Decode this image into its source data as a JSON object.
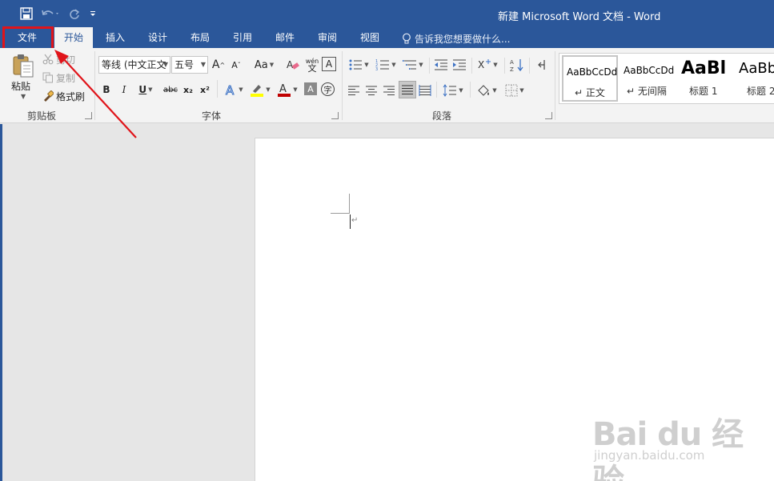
{
  "titlebar": {
    "title": "新建 Microsoft Word 文档 - Word"
  },
  "tabs": [
    {
      "label": "文件"
    },
    {
      "label": "开始"
    },
    {
      "label": "插入"
    },
    {
      "label": "设计"
    },
    {
      "label": "布局"
    },
    {
      "label": "引用"
    },
    {
      "label": "邮件"
    },
    {
      "label": "审阅"
    },
    {
      "label": "视图"
    }
  ],
  "tell_me": "告诉我您想要做什么...",
  "clipboard": {
    "paste": "粘贴",
    "cut": "剪切",
    "copy": "复制",
    "format_painter": "格式刷",
    "group_label": "剪贴板"
  },
  "font": {
    "font_name": "等线 (中文正文",
    "font_size": "五号",
    "change_case": "Aa",
    "bold": "B",
    "italic": "I",
    "underline": "U",
    "strikethrough": "abc",
    "subscript": "x₂",
    "superscript": "x²",
    "grow": "A",
    "shrink": "A",
    "clear": "A",
    "char_border": "A",
    "phonetic": "wén",
    "enclose": "字",
    "group_label": "字体"
  },
  "paragraph": {
    "group_label": "段落"
  },
  "styles": {
    "items": [
      {
        "sample": "AaBbCcDd",
        "name": "↵ 正文"
      },
      {
        "sample": "AaBbCcDd",
        "name": "↵ 无间隔"
      },
      {
        "sample": "AaBl",
        "name": "标题 1"
      },
      {
        "sample": "AaBb",
        "name": "标题 2"
      }
    ]
  },
  "document": {
    "paragraph_mark": "↵"
  },
  "watermark": {
    "main": "Bai du 经验",
    "sub": "jingyan.baidu.com"
  },
  "colors": {
    "brand": "#2b579a",
    "ribbon": "#f3f3f3",
    "highlight_red": "#e0141a",
    "highlighter_yellow": "#ffff00",
    "font_color_red": "#c00000"
  }
}
